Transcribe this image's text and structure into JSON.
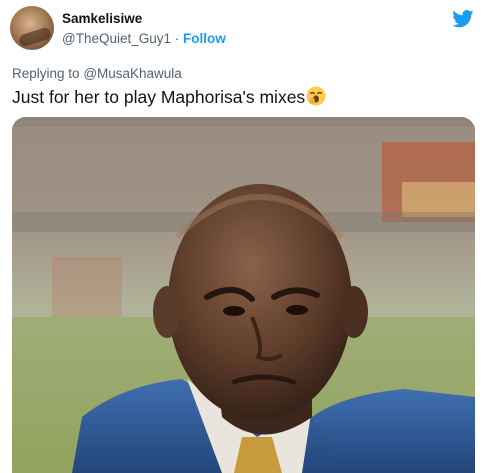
{
  "author": {
    "display_name": "Samkelisiwe",
    "handle": "@TheQuiet_Guy1",
    "separator": "·",
    "follow_label": "Follow"
  },
  "reply": {
    "prefix": "Replying to",
    "handle": "@MusaKhawula"
  },
  "tweet": {
    "text": "Just for her to play Maphorisa's mixes"
  },
  "icons": {
    "platform": "twitter-bird-icon",
    "emoji": "yawning-face-emoji"
  },
  "colors": {
    "accent": "#1d9bf0",
    "secondary_text": "#536471",
    "primary_text": "#0f1419"
  }
}
